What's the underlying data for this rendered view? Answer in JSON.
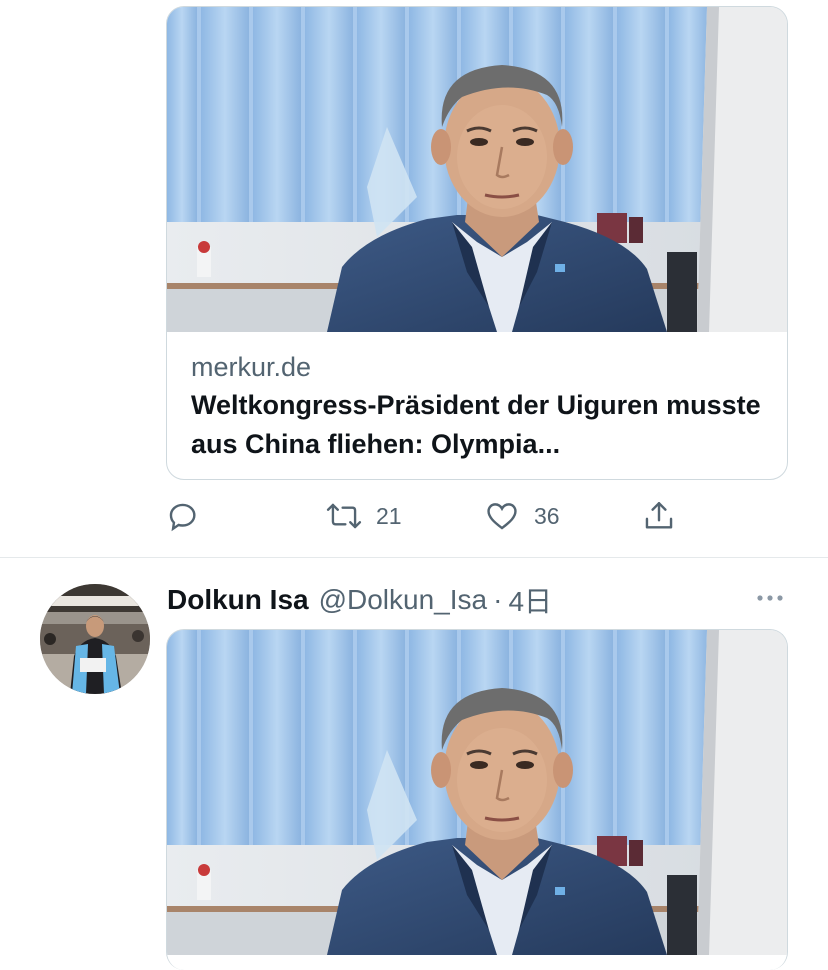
{
  "tweet1": {
    "card": {
      "image_alt": "man in suit in office",
      "domain": "merkur.de",
      "headline": "Weltkongress-Präsident der Uiguren musste aus China fliehen: Olympia..."
    },
    "actions": {
      "reply_icon": "reply-icon",
      "retweet_icon": "retweet-icon",
      "retweet_count": "21",
      "like_icon": "heart-icon",
      "like_count": "36",
      "share_icon": "share-icon"
    }
  },
  "tweet2": {
    "display_name": "Dolkun Isa",
    "handle": "@Dolkun_Isa",
    "separator": "·",
    "time": "4日",
    "more_icon": "more-icon",
    "card": {
      "image_alt": "man in suit in office"
    }
  },
  "colors": {
    "text": "#0f1419",
    "muted": "#536471",
    "border": "#cfd9de",
    "accent_blue": "#9ec6ea"
  }
}
